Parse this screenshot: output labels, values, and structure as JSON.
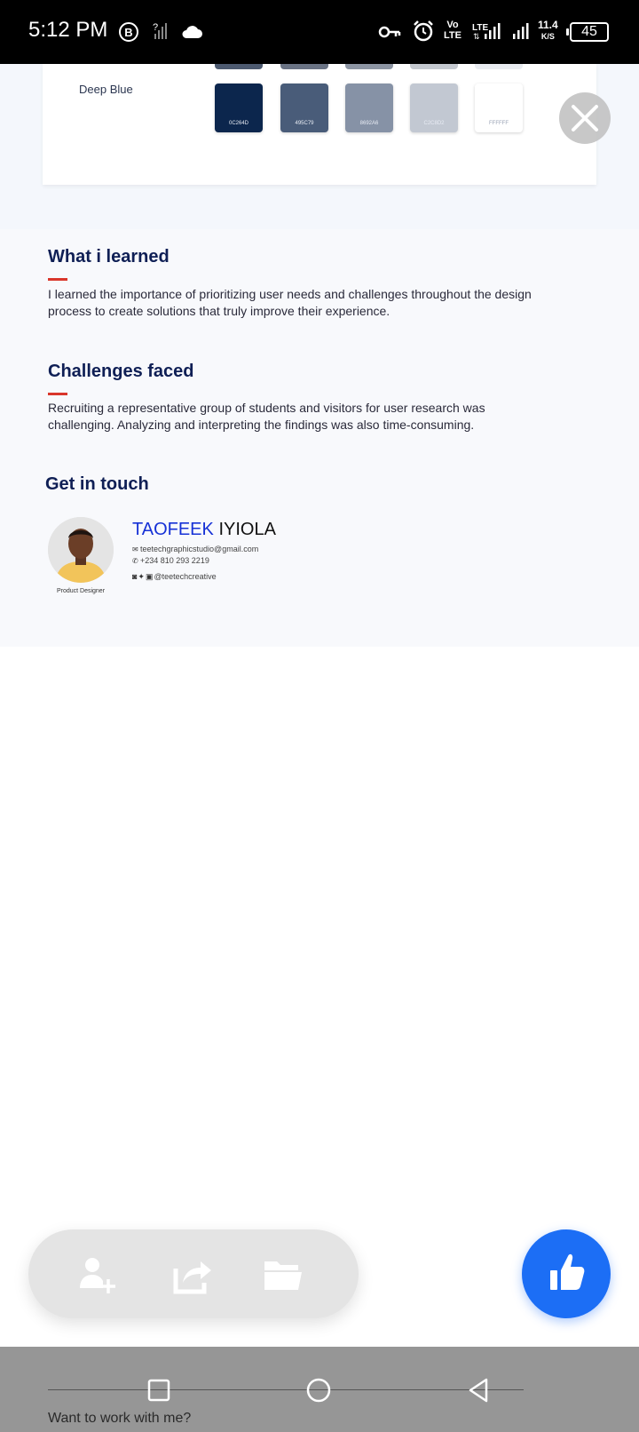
{
  "status_bar": {
    "time": "5:12 PM",
    "b_badge": "B",
    "sim1_label": "?",
    "volte_top": "Vo",
    "volte_bottom": "LTE",
    "lte_label": "LTE",
    "speed_value": "11.4",
    "speed_unit": "K/S",
    "battery": "45"
  },
  "palette": {
    "name": "Deep Blue",
    "swatches": [
      {
        "code": "0C264D",
        "color": "#0C264D"
      },
      {
        "code": "495C79",
        "color": "#495C79"
      },
      {
        "code": "8692A6",
        "color": "#8692A6"
      },
      {
        "code": "C2C8D2",
        "color": "#C2C8D2"
      },
      {
        "code": "FFFFFF",
        "color": "#FFFFFF"
      }
    ]
  },
  "learned": {
    "title": "What i learned",
    "body": "I learned the importance of prioritizing user needs and challenges throughout the design process to create solutions that truly improve their experience."
  },
  "challenges": {
    "title": "Challenges faced",
    "body": "Recruiting a representative group of students and visitors for user research was challenging. Analyzing and interpreting the findings was also time-consuming."
  },
  "contact": {
    "title": "Get in touch",
    "first_name": "TAOFEEK",
    "last_name": "IYIOLA",
    "email": "teetechgraphicstudio@gmail.com",
    "phone": "+234 810 293 2219",
    "social_handle": "@teetechcreative",
    "role": "Product Designer"
  },
  "nav": {
    "footer_text": "Want to work with me?"
  },
  "colors": {
    "accent_blue": "#1c6ef5",
    "heading_navy": "#0f1f55",
    "rule_red": "#d9362b",
    "name_blue": "#1631d6"
  }
}
